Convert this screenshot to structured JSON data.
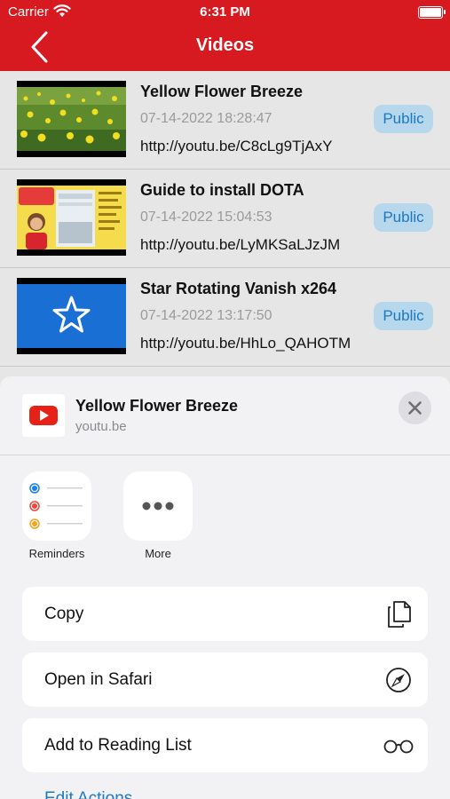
{
  "status": {
    "carrier": "Carrier",
    "time": "6:31 PM"
  },
  "nav": {
    "title": "Videos"
  },
  "videos": [
    {
      "title": "Yellow Flower Breeze",
      "date": "07-14-2022 18:28:47",
      "url": "http://youtu.be/C8cLg9TjAxY",
      "visibility": "Public"
    },
    {
      "title": "Guide to install DOTA",
      "date": "07-14-2022 15:04:53",
      "url": "http://youtu.be/LyMKSaLJzJM",
      "visibility": "Public"
    },
    {
      "title": "Star Rotating Vanish x264",
      "date": "07-14-2022 13:17:50",
      "url": "http://youtu.be/HhLo_QAHOTM",
      "visibility": "Public"
    }
  ],
  "share": {
    "title": "Yellow Flower Breeze",
    "subtitle": "youtu.be",
    "apps": [
      {
        "label": "Reminders"
      },
      {
        "label": "More"
      }
    ],
    "actions": [
      {
        "label": "Copy",
        "icon": "copy-icon"
      },
      {
        "label": "Open in Safari",
        "icon": "compass-icon"
      },
      {
        "label": "Add to Reading List",
        "icon": "glasses-icon"
      }
    ],
    "edit_label": "Edit Actions..."
  },
  "colors": {
    "brand": "#d71920",
    "badge_bg": "#b6d7ec",
    "badge_text": "#1b78c4"
  }
}
